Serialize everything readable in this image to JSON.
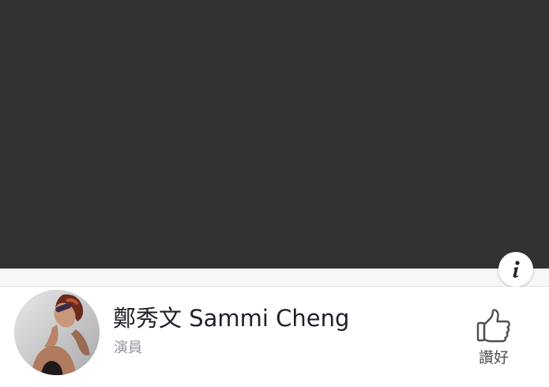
{
  "header": {
    "cover_color": "#323232",
    "info_button_icon": "info-icon"
  },
  "profile": {
    "avatar_icon": "profile-photo",
    "name": "鄭秀文 Sammi Cheng",
    "category": "演員"
  },
  "actions": {
    "like_label": "讚好",
    "like_icon": "thumbs-up-icon"
  },
  "colors": {
    "text_primary": "#1d2129",
    "text_secondary": "#90949c",
    "icon_gray": "#4b4f56"
  }
}
